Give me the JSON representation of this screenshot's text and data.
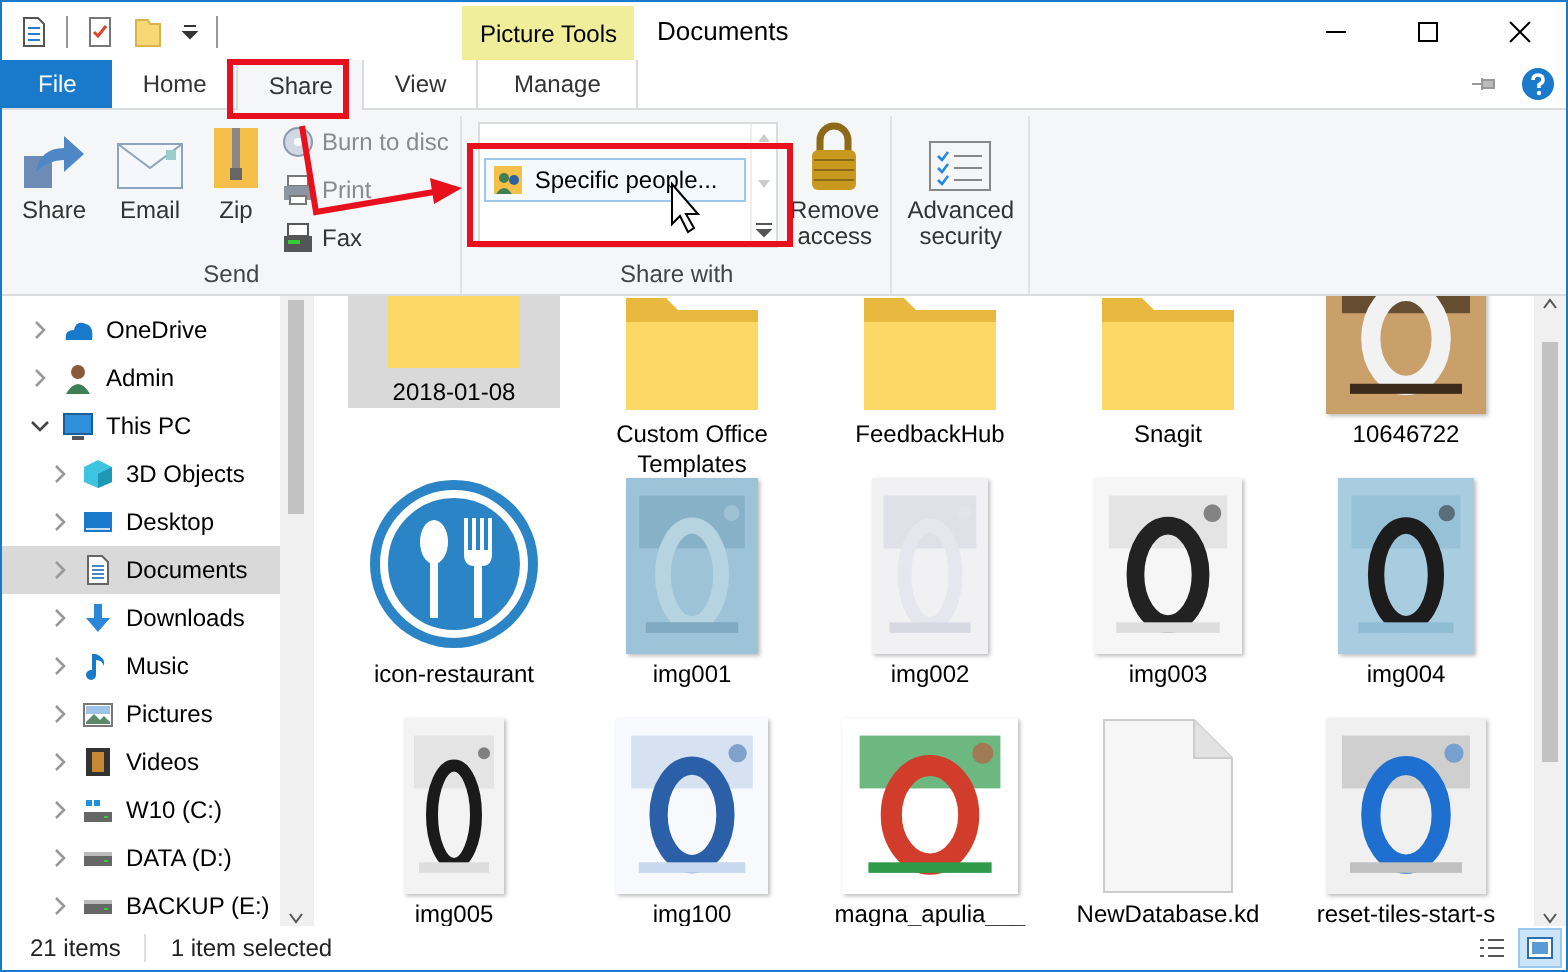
{
  "window": {
    "title": "Documents",
    "contextual_tab": "Picture Tools"
  },
  "tabs": [
    {
      "label": "File",
      "kind": "file",
      "selected": false
    },
    {
      "label": "Home",
      "kind": "tab",
      "selected": false
    },
    {
      "label": "Share",
      "kind": "tab",
      "selected": true
    },
    {
      "label": "View",
      "kind": "tab",
      "selected": false
    },
    {
      "label": "Manage",
      "kind": "contextual",
      "selected": false
    }
  ],
  "ribbon": {
    "send": {
      "label": "Send",
      "large": [
        {
          "label": "Share"
        },
        {
          "label": "Email"
        },
        {
          "label": "Zip"
        }
      ],
      "small": [
        {
          "label": "Burn to disc",
          "disabled": true
        },
        {
          "label": "Print",
          "disabled": true
        },
        {
          "label": "Fax",
          "disabled": false
        }
      ]
    },
    "share_with": {
      "label": "Share with",
      "list": [
        "Specific people..."
      ],
      "remove": "Remove access"
    },
    "advanced": {
      "label": "Advanced security"
    }
  },
  "nav": [
    {
      "label": "OneDrive",
      "expanded": false,
      "selected": false
    },
    {
      "label": "Admin",
      "expanded": false,
      "selected": false
    },
    {
      "label": "This PC",
      "expanded": true,
      "selected": false,
      "children": [
        {
          "label": "3D Objects",
          "expanded": false,
          "selected": false
        },
        {
          "label": "Desktop",
          "expanded": false,
          "selected": false
        },
        {
          "label": "Documents",
          "expanded": false,
          "selected": true
        },
        {
          "label": "Downloads",
          "expanded": false,
          "selected": false
        },
        {
          "label": "Music",
          "expanded": false,
          "selected": false
        },
        {
          "label": "Pictures",
          "expanded": false,
          "selected": false
        },
        {
          "label": "Videos",
          "expanded": false,
          "selected": false
        },
        {
          "label": "W10 (C:)",
          "expanded": false,
          "selected": false
        },
        {
          "label": "DATA (D:)",
          "expanded": false,
          "selected": false
        },
        {
          "label": "BACKUP (E:)",
          "expanded": false,
          "selected": false
        }
      ]
    }
  ],
  "files": [
    {
      "name": "2018-01-08",
      "kind": "folder",
      "selected": true
    },
    {
      "name": "Custom Office Templates",
      "kind": "folder",
      "selected": false
    },
    {
      "name": "FeedbackHub",
      "kind": "folder",
      "selected": false
    },
    {
      "name": "Snagit",
      "kind": "folder",
      "selected": false
    },
    {
      "name": "10646722",
      "kind": "picture",
      "selected": false
    },
    {
      "name": "icon-restaurant",
      "kind": "icon",
      "selected": false
    },
    {
      "name": "img001",
      "kind": "picture",
      "selected": false
    },
    {
      "name": "img002",
      "kind": "picture",
      "selected": false
    },
    {
      "name": "img003",
      "kind": "picture",
      "selected": false
    },
    {
      "name": "img004",
      "kind": "picture",
      "selected": false
    },
    {
      "name": "img005",
      "kind": "picture",
      "selected": false
    },
    {
      "name": "img100",
      "kind": "picture",
      "selected": false
    },
    {
      "name": "magna_apulia___",
      "kind": "picture",
      "selected": false
    },
    {
      "name": "NewDatabase.kd",
      "kind": "document",
      "selected": false
    },
    {
      "name": "reset-tiles-start-s",
      "kind": "picture",
      "selected": false
    }
  ],
  "views": [
    {
      "kind": "details",
      "selected": false
    },
    {
      "kind": "large_icons",
      "selected": true
    }
  ],
  "status_bar": {
    "count": "21 items",
    "selection": "1 item selected"
  }
}
